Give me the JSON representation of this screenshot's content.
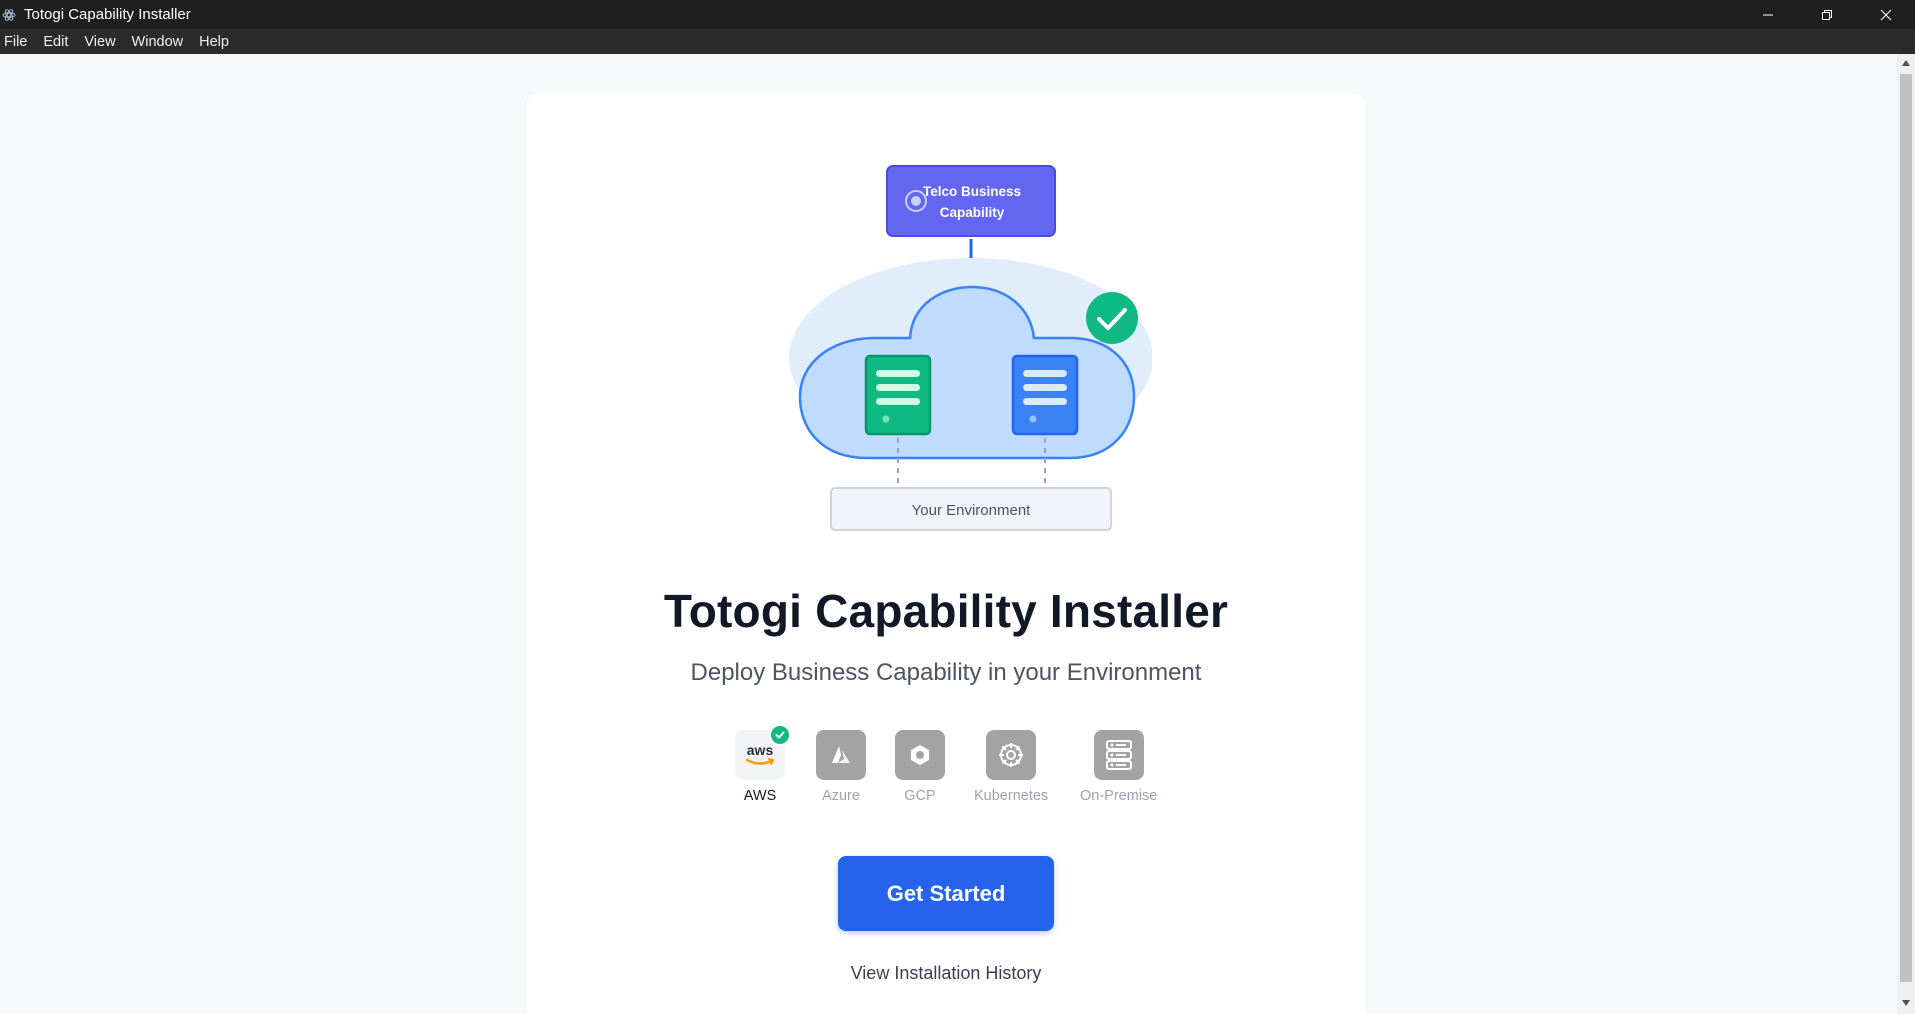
{
  "window": {
    "title": "Totogi Capability Installer"
  },
  "menu": {
    "items": [
      "File",
      "Edit",
      "View",
      "Window",
      "Help"
    ]
  },
  "illustration": {
    "capability_label_line1": "Telco Business",
    "capability_label_line2": "Capability",
    "environment_label": "Your Environment"
  },
  "hero": {
    "title": "Totogi Capability Installer",
    "subtitle": "Deploy Business Capability in your Environment"
  },
  "providers": [
    {
      "name": "AWS",
      "icon": "aws-logo-icon",
      "selected": true,
      "tile_text": "aws"
    },
    {
      "name": "Azure",
      "icon": "azure-icon",
      "selected": false
    },
    {
      "name": "GCP",
      "icon": "gcp-icon",
      "selected": false
    },
    {
      "name": "Kubernetes",
      "icon": "kubernetes-icon",
      "selected": false
    },
    {
      "name": "On-Premise",
      "icon": "server-icon",
      "selected": false
    }
  ],
  "actions": {
    "primary_label": "Get Started",
    "history_label": "View Installation History"
  },
  "colors": {
    "primary": "#2563eb",
    "success": "#10b981",
    "capability_box": "#6366f1",
    "cloud_fill": "#bfdbfe",
    "cloud_stroke": "#3b82f6"
  }
}
